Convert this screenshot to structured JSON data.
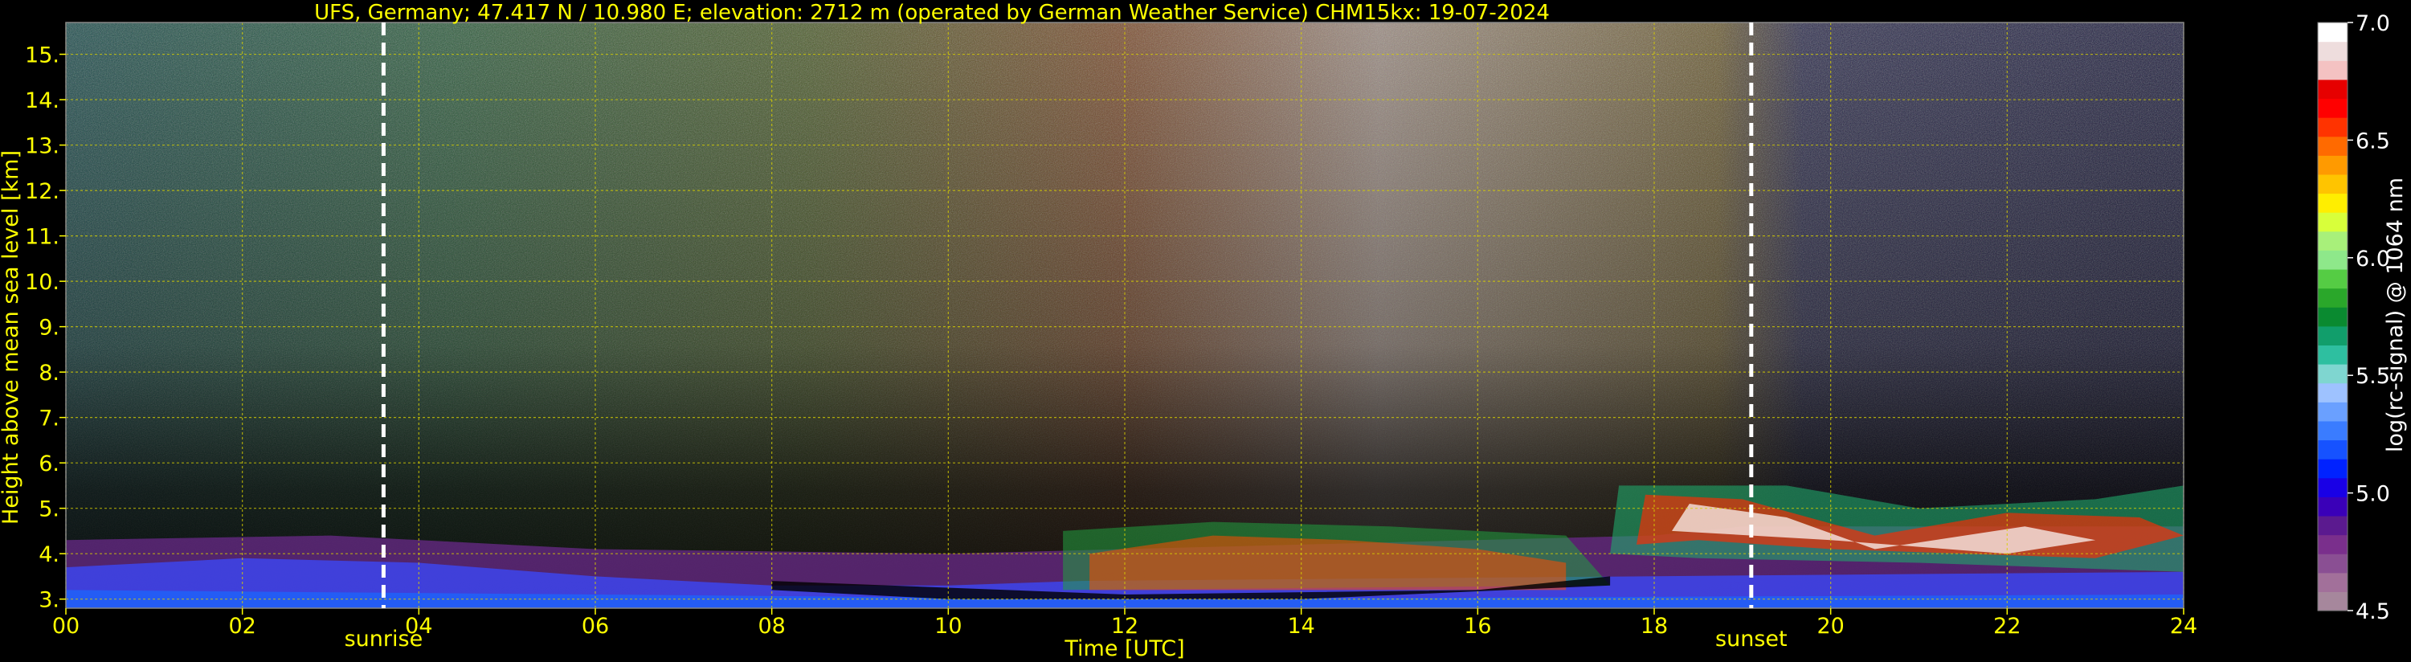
{
  "chart_data": {
    "type": "heatmap",
    "title": "UFS, Germany; 47.417 N / 10.980 E; elevation: 2712 m  (operated by German Weather Service)    CHM15kx: 19-07-2024",
    "xlabel": "Time [UTC]",
    "ylabel": "Height above mean sea level [km]",
    "xlim": [
      0,
      24
    ],
    "ylim": [
      2.8,
      15.7
    ],
    "x_ticks": [
      "00",
      "02",
      "04",
      "06",
      "08",
      "10",
      "12",
      "14",
      "16",
      "18",
      "20",
      "22",
      "24"
    ],
    "x_tick_values": [
      0,
      2,
      4,
      6,
      8,
      10,
      12,
      14,
      16,
      18,
      20,
      22,
      24
    ],
    "y_ticks": [
      "3.",
      "4.",
      "5.",
      "6.",
      "7.",
      "8.",
      "9.",
      "10.",
      "11.",
      "12.",
      "13.",
      "14.",
      "15."
    ],
    "y_tick_values": [
      3,
      4,
      5,
      6,
      7,
      8,
      9,
      10,
      11,
      12,
      13,
      14,
      15
    ],
    "grid": true,
    "markers": [
      {
        "label": "sunrise",
        "x": 3.6
      },
      {
        "label": "sunset",
        "x": 19.1
      }
    ],
    "colorbar": {
      "label": "log(rc-signal) @ 1064 nm",
      "min": 4.5,
      "max": 7.0,
      "ticks": [
        "4.5",
        "5.0",
        "5.5",
        "6.0",
        "6.5",
        "7.0"
      ],
      "tick_values": [
        4.5,
        5.0,
        5.5,
        6.0,
        6.5,
        7.0
      ],
      "colors": [
        "#a6879c",
        "#a2709a",
        "#8a4f93",
        "#7a2f8c",
        "#5b1a8f",
        "#3a00b8",
        "#1900e6",
        "#0022ff",
        "#1652ff",
        "#3a7cff",
        "#6aa0ff",
        "#9ec2ff",
        "#7fd6d0",
        "#2ebfa0",
        "#119e6b",
        "#0a8a30",
        "#2aa72a",
        "#55cc44",
        "#8ee88a",
        "#a8f07a",
        "#d8ff3a",
        "#ffee00",
        "#ffc400",
        "#ff9a00",
        "#ff6a00",
        "#ff3300",
        "#ff0000",
        "#e60000",
        "#f4c2c2",
        "#eedddd",
        "#ffffff"
      ]
    }
  }
}
